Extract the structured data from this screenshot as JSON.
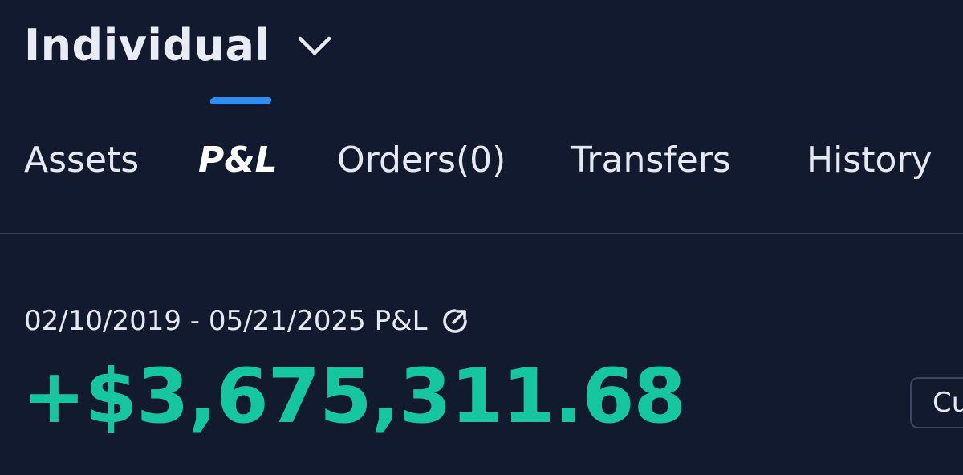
{
  "account": {
    "name": "Individual",
    "dropdown_icon": "chevron-down-icon"
  },
  "tabs": [
    {
      "label": "Assets",
      "active": false
    },
    {
      "label": "P&L",
      "active": true
    },
    {
      "label": "Orders(0)",
      "active": false
    },
    {
      "label": "Transfers",
      "active": false
    },
    {
      "label": "History",
      "active": false
    }
  ],
  "pl": {
    "range": "02/10/2019 - 05/21/2025 P&L",
    "share_icon": "share-icon",
    "value": "+$3,675,311.68",
    "currency_label": "Cu"
  },
  "colors": {
    "background": "#121a30",
    "accent": "#2f8ef0",
    "positive": "#16c6a1",
    "text": "#e9ecf4"
  }
}
